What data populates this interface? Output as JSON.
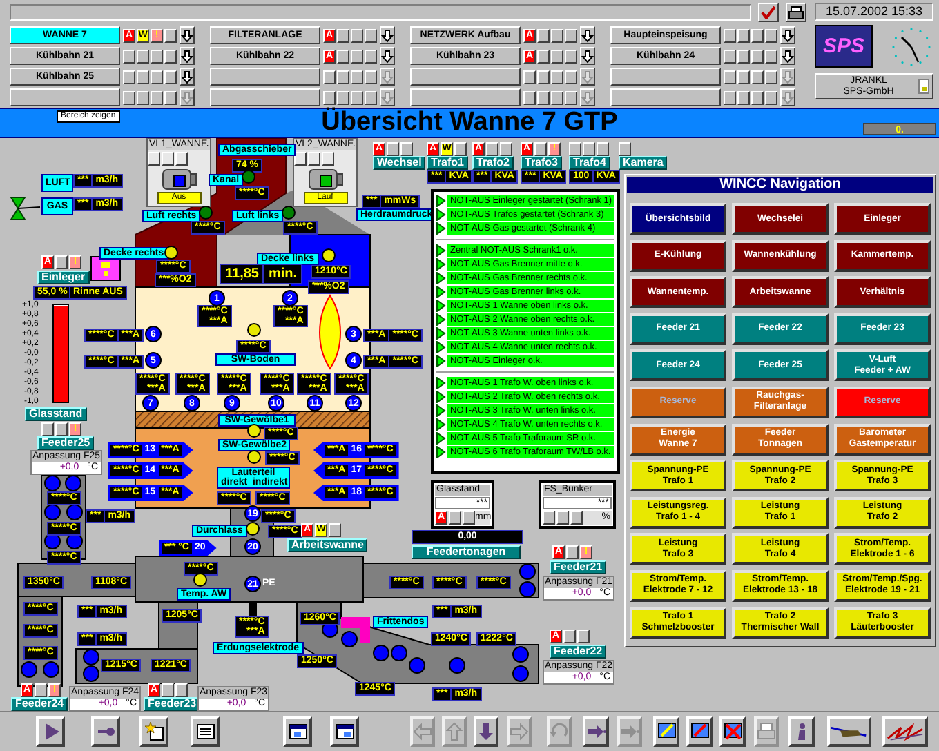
{
  "top_bar": {
    "datetime": "15.07.2002 15:33",
    "logo": "SPS",
    "company": [
      "JRANKL",
      "SPS-GmbH"
    ]
  },
  "areas": [
    {
      "label": "WANNE 7",
      "selected": true,
      "disabled": false,
      "alarms": [
        {
          "kind": "alarm",
          "text": "A"
        },
        {
          "kind": "warning",
          "text": "W"
        },
        {
          "kind": "info",
          "text": "!"
        },
        {
          "kind": "off"
        }
      ]
    },
    {
      "label": "FILTERANLAGE",
      "selected": false,
      "disabled": false,
      "alarms": [
        {
          "kind": "alarm",
          "text": "A"
        },
        {
          "kind": "off"
        },
        {
          "kind": "off"
        },
        {
          "kind": "off"
        }
      ]
    },
    {
      "label": "NETZWERK Aufbau",
      "selected": false,
      "disabled": false,
      "alarms": [
        {
          "kind": "alarm",
          "text": "A"
        },
        {
          "kind": "off"
        },
        {
          "kind": "off"
        },
        {
          "kind": "off"
        }
      ]
    },
    {
      "label": "Haupteinspeisung",
      "selected": false,
      "disabled": false,
      "alarms": [
        {
          "kind": "off"
        },
        {
          "kind": "off"
        },
        {
          "kind": "off"
        },
        {
          "kind": "off"
        }
      ]
    },
    {
      "label": "Kühlbahn 21",
      "selected": false,
      "disabled": false,
      "alarms": [
        {
          "kind": "off"
        },
        {
          "kind": "off"
        },
        {
          "kind": "off"
        },
        {
          "kind": "off"
        }
      ]
    },
    {
      "label": "Kühlbahn 22",
      "selected": false,
      "disabled": false,
      "alarms": [
        {
          "kind": "alarm",
          "text": "A"
        },
        {
          "kind": "off"
        },
        {
          "kind": "off"
        },
        {
          "kind": "off"
        }
      ]
    },
    {
      "label": "Kühlbahn 23",
      "selected": false,
      "disabled": false,
      "alarms": [
        {
          "kind": "alarm",
          "text": "A"
        },
        {
          "kind": "off"
        },
        {
          "kind": "off"
        },
        {
          "kind": "off"
        }
      ]
    },
    {
      "label": "Kühlbahn 24",
      "selected": false,
      "disabled": false,
      "alarms": [
        {
          "kind": "off"
        },
        {
          "kind": "off"
        },
        {
          "kind": "off"
        },
        {
          "kind": "off"
        }
      ]
    },
    {
      "label": "Kühlbahn 25",
      "selected": false,
      "disabled": false,
      "alarms": [
        {
          "kind": "off"
        },
        {
          "kind": "off"
        },
        {
          "kind": "off"
        },
        {
          "kind": "off"
        }
      ]
    },
    {
      "selected": false,
      "disabled": true,
      "alarms": [
        {
          "kind": "off"
        },
        {
          "kind": "off"
        },
        {
          "kind": "off"
        },
        {
          "kind": "off"
        }
      ]
    },
    {
      "selected": false,
      "disabled": true,
      "alarms": [
        {
          "kind": "off"
        },
        {
          "kind": "off"
        },
        {
          "kind": "off"
        },
        {
          "kind": "off"
        }
      ]
    },
    {
      "selected": false,
      "disabled": true,
      "alarms": [
        {
          "kind": "off"
        },
        {
          "kind": "off"
        },
        {
          "kind": "off"
        },
        {
          "kind": "off"
        }
      ]
    },
    {
      "selected": false,
      "disabled": true,
      "alarms": [
        {
          "kind": "off"
        },
        {
          "kind": "off"
        },
        {
          "kind": "off"
        },
        {
          "kind": "off"
        }
      ]
    },
    {
      "selected": false,
      "disabled": true,
      "alarms": [
        {
          "kind": "off"
        },
        {
          "kind": "off"
        },
        {
          "kind": "off"
        },
        {
          "kind": "off"
        }
      ]
    },
    {
      "selected": false,
      "disabled": true,
      "alarms": [
        {
          "kind": "off"
        },
        {
          "kind": "off"
        },
        {
          "kind": "off"
        },
        {
          "kind": "off"
        }
      ]
    },
    {
      "selected": false,
      "disabled": true,
      "alarms": [
        {
          "kind": "off"
        },
        {
          "kind": "off"
        },
        {
          "kind": "off"
        },
        {
          "kind": "off"
        }
      ]
    }
  ],
  "title_bar": {
    "button": "Bereich zeigen",
    "title": "Übersicht Wanne 7 GTP",
    "value": "0."
  },
  "plant": {
    "fans": [
      {
        "title": "VL1_WANNE",
        "status": "Aus",
        "running": false
      },
      {
        "title": "VL2_WANNE",
        "status": "Lauf",
        "running": true
      }
    ],
    "tags": [
      "Abgasschieber",
      "LUFT",
      "Kanal",
      "GAS",
      "Luft rechts",
      "Luft links",
      "Herdraumdruck",
      "Decke rechts",
      "Decke links",
      "SW-Boden",
      "SW-Gewölbe1",
      "SW-Gewölbe2",
      "Lauterteil\ndirekt  indirekt",
      "Durchlass",
      "Temp. AW",
      "Frittendos",
      "Erdungselektrode"
    ],
    "readouts": [
      [
        "74 %"
      ],
      [
        "***",
        "KVA"
      ],
      [
        "***",
        "KVA"
      ],
      [
        "***",
        "KVA"
      ],
      [
        "100",
        "KVA"
      ],
      [
        "***",
        "m3/h"
      ],
      [
        "****°C"
      ],
      [
        "***",
        "mmWs"
      ],
      [
        "***",
        "m3/h"
      ],
      [
        "****°C"
      ],
      [
        "****°C"
      ],
      [
        "****°C"
      ],
      [
        "11,85",
        "min."
      ],
      [
        "1210°C"
      ],
      [
        "***%O2"
      ],
      [
        "***%O2"
      ],
      [
        "55,0 %"
      ],
      [
        "Rinne AUS"
      ],
      [
        "****°C",
        "***A"
      ],
      [
        "****°C",
        "***A"
      ],
      [
        "****°C",
        "***A"
      ],
      [
        "***A",
        "****°C"
      ],
      [
        "****°C"
      ],
      [
        "****°C",
        "***A"
      ],
      [
        "***A",
        "****°C"
      ],
      [
        "****°C",
        "***A"
      ],
      [
        "****°C",
        "***A"
      ],
      [
        "****°C",
        "***A"
      ],
      [
        "****°C",
        "***A"
      ],
      [
        "****°C",
        "***A"
      ],
      [
        "****°C",
        "***A"
      ],
      [
        "****°C"
      ],
      [
        "****°C"
      ],
      [
        "****°C"
      ],
      [
        "****°C"
      ],
      [
        "****°C"
      ],
      [
        "***",
        "m3/h"
      ],
      [
        "****°C"
      ],
      [
        "****°C"
      ],
      [
        "****°C"
      ],
      [
        "0,00"
      ],
      [
        "****°C"
      ],
      [
        "****°C"
      ],
      [
        "1350°C"
      ],
      [
        "1108°C"
      ],
      [
        "****°C"
      ],
      [
        "****°C"
      ],
      [
        "****°C"
      ],
      [
        "****°C"
      ],
      [
        "***",
        "m3/h"
      ],
      [
        "***",
        "m3/h"
      ],
      [
        "1205°C"
      ],
      [
        "1260°C"
      ],
      [
        "****°C"
      ],
      [
        "****°C",
        "***A"
      ],
      [
        "***",
        "m3/h"
      ],
      [
        "1240°C"
      ],
      [
        "1222°C"
      ],
      [
        "****°C"
      ],
      [
        "1250°C"
      ],
      [
        "1215°C"
      ],
      [
        "1221°C"
      ],
      [
        "1245°C"
      ],
      [
        "***",
        "m3/h"
      ]
    ],
    "arrow_readouts": [
      {
        "kind": "right",
        "parts": [
          "****°C",
          "13",
          "***A"
        ]
      },
      {
        "kind": "left",
        "parts": [
          "***A",
          "16",
          "****°C"
        ]
      },
      {
        "kind": "right",
        "parts": [
          "****°C",
          "14",
          "***A"
        ]
      },
      {
        "kind": "left",
        "parts": [
          "***A",
          "17",
          "****°C"
        ]
      },
      {
        "kind": "right",
        "parts": [
          "****°C",
          "15",
          "***A"
        ]
      },
      {
        "kind": "left",
        "parts": [
          "***A",
          "18",
          "****°C"
        ]
      },
      {
        "kind": "right",
        "parts": [
          "*** °C",
          "20"
        ]
      }
    ],
    "electrodes": [
      "1",
      "2",
      "6",
      "3",
      "5",
      "4",
      "7",
      "8",
      "9",
      "10",
      "11",
      "12",
      "19",
      "20",
      "21"
    ],
    "pe_label": "PE",
    "lamps": [
      {
        "color": "#008000"
      },
      {
        "color": "#008000"
      },
      {
        "color": "#008000"
      },
      {
        "color": "#e8e800"
      },
      {
        "color": "#e8e800"
      },
      {
        "color": "#e8e800"
      },
      {
        "color": "#e8e800"
      },
      {
        "color": "#e8e800"
      },
      {
        "color": "#e8e800"
      },
      {
        "color": "#e8e800"
      }
    ],
    "units": [
      {
        "label": "Wechsel",
        "alarms": [
          {
            "kind": "alarm",
            "text": "A"
          },
          {
            "kind": "off"
          },
          {
            "kind": "off"
          }
        ]
      },
      {
        "label": "Trafo1",
        "alarms": [
          {
            "kind": "alarm",
            "text": "A"
          },
          {
            "kind": "warning",
            "text": "W"
          },
          {
            "kind": "off"
          }
        ]
      },
      {
        "label": "Trafo2",
        "alarms": [
          {
            "kind": "alarm",
            "text": "A"
          },
          {
            "kind": "off"
          },
          {
            "kind": "off"
          }
        ]
      },
      {
        "label": "Trafo3",
        "alarms": [
          {
            "kind": "alarm",
            "text": "A"
          },
          {
            "kind": "off"
          },
          {
            "kind": "info",
            "text": "!"
          }
        ]
      },
      {
        "label": "Trafo4",
        "alarms": [
          {
            "kind": "off"
          },
          {
            "kind": "off"
          },
          {
            "kind": "off"
          }
        ]
      },
      {
        "label": "Kamera",
        "alarms": [
          {
            "kind": "off"
          }
        ]
      },
      {
        "label": "Einleger",
        "alarms": [
          {
            "kind": "alarm",
            "text": "A"
          },
          {
            "kind": "off"
          },
          {
            "kind": "info",
            "text": "!"
          }
        ]
      },
      {
        "label": "Feeder25",
        "alarms": [
          {
            "kind": "off"
          },
          {
            "kind": "off"
          },
          {
            "kind": "info",
            "text": "!"
          }
        ],
        "adjust": {
          "label": "Anpassung F25",
          "value": "+0,0",
          "unit": "°C"
        }
      },
      {
        "label": "Arbeitswanne",
        "alarms": [
          {
            "kind": "alarm",
            "text": "A"
          },
          {
            "kind": "warning",
            "text": "W"
          },
          {
            "kind": "off"
          }
        ]
      },
      {
        "label": "Feeder21",
        "alarms": [
          {
            "kind": "alarm",
            "text": "A"
          },
          {
            "kind": "off"
          },
          {
            "kind": "info",
            "text": "!"
          }
        ],
        "adjust": {
          "label": "Anpassung F21",
          "value": "+0,0",
          "unit": "°C"
        }
      },
      {
        "label": "Feeder22",
        "alarms": [
          {
            "kind": "alarm",
            "text": "A"
          },
          {
            "kind": "off"
          },
          {
            "kind": "off"
          }
        ],
        "adjust": {
          "label": "Anpassung F22",
          "value": "+0,0",
          "unit": "°C"
        }
      },
      {
        "label": "Feeder24",
        "alarms": [
          {
            "kind": "alarm",
            "text": "A"
          },
          {
            "kind": "off"
          },
          {
            "kind": "info",
            "text": "!"
          }
        ],
        "adjust": {
          "label": "Anpassung F24",
          "value": "+0,0",
          "unit": "°C"
        }
      },
      {
        "label": "Feeder23",
        "alarms": [
          {
            "kind": "alarm",
            "text": "A"
          },
          {
            "kind": "off"
          },
          {
            "kind": "off"
          }
        ],
        "adjust": {
          "label": "Anpassung F23",
          "value": "+0,0",
          "unit": "°C"
        }
      }
    ],
    "glass_level": {
      "label": "Glasstand",
      "scale": [
        "+1,0",
        "+0,8",
        "+0,6",
        "+0,4",
        "+0,2",
        "-0,0",
        "-0,2",
        "-0,4",
        "-0,6",
        "-0,8",
        "-1,0"
      ],
      "level": 0.98
    },
    "mini_panels": [
      {
        "title": "Glasstand",
        "value": "***",
        "unit": "mm",
        "alarms": [
          {
            "kind": "alarm",
            "text": "A"
          },
          {
            "kind": "off"
          },
          {
            "kind": "off"
          }
        ]
      },
      {
        "title": "FS_Bunker",
        "value": "***",
        "unit": "%",
        "alarms": [
          {
            "kind": "off"
          },
          {
            "kind": "off"
          },
          {
            "kind": "off"
          }
        ]
      }
    ],
    "feeder_tonnage_label": "Feedertonagen",
    "emergency_stops": [
      [
        {
          "text": "NOT-AUS Einleger gestartet (Schrank 1)",
          "ok": true
        },
        {
          "text": "NOT-AUS Trafos gestartet (Schrank 3)",
          "ok": true
        },
        {
          "text": "NOT-AUS Gas gestartet (Schrank 4)",
          "ok": true
        }
      ],
      [
        {
          "text": "Zentral NOT-AUS Schrank1 o.k.",
          "ok": true
        },
        {
          "text": "NOT-AUS Gas Brenner mitte o.k.",
          "ok": true
        },
        {
          "text": "NOT-AUS Gas Brenner rechts o.k.",
          "ok": true
        },
        {
          "text": "NOT-AUS Gas Brenner links o.k.",
          "ok": true
        },
        {
          "text": "NOT-AUS 1 Wanne oben links o.k.",
          "ok": true
        },
        {
          "text": "NOT-AUS 2 Wanne oben rechts o.k.",
          "ok": true
        },
        {
          "text": "NOT-AUS 3 Wanne unten links o.k.",
          "ok": true
        },
        {
          "text": "NOT-AUS 4 Wanne unten rechts o.k.",
          "ok": true
        },
        {
          "text": "NOT-AUS Einleger o.k.",
          "ok": true
        }
      ],
      [
        {
          "text": "NOT-AUS 1 Trafo W. oben links o.k.",
          "ok": true
        },
        {
          "text": "NOT-AUS 2 Trafo W. oben rechts o.k.",
          "ok": true
        },
        {
          "text": "NOT-AUS 3 Trafo W. unten links o.k.",
          "ok": true
        },
        {
          "text": "NOT-AUS 4 Trafo W. unten rechts o.k.",
          "ok": true
        },
        {
          "text": "NOT-AUS 5 Trafo Traforaum SR o.k.",
          "ok": true
        },
        {
          "text": "NOT-AUS 6 Trafo Traforaum TW/LB o.k.",
          "ok": true
        }
      ]
    ]
  },
  "navigation": {
    "title": "WINCC Navigation",
    "buttons": [
      {
        "label": "Übersichtsbild",
        "color": "#000080",
        "disabled": false
      },
      {
        "label": "Wechselei",
        "color": "#800000",
        "disabled": false
      },
      {
        "label": "Einleger",
        "color": "#800000",
        "disabled": false
      },
      {
        "label": "E-Kühlung",
        "color": "#800000",
        "disabled": false
      },
      {
        "label": "Wannenkühlung",
        "color": "#800000",
        "disabled": false
      },
      {
        "label": "Kammertemp.",
        "color": "#800000",
        "disabled": false
      },
      {
        "label": "Wannentemp.",
        "color": "#800000",
        "disabled": false
      },
      {
        "label": "Arbeitswanne",
        "color": "#800000",
        "disabled": false
      },
      {
        "label": "Verhältnis",
        "color": "#800000",
        "disabled": false
      },
      {
        "label": "Feeder 21",
        "color": "#008080",
        "disabled": false
      },
      {
        "label": "Feeder 22",
        "color": "#008080",
        "disabled": false
      },
      {
        "label": "Feeder 23",
        "color": "#008080",
        "disabled": false
      },
      {
        "label": "Feeder 24",
        "color": "#008080",
        "disabled": false
      },
      {
        "label": "Feeder 25",
        "color": "#008080",
        "disabled": false
      },
      {
        "label": "V-Luft\nFeeder + AW",
        "color": "#008080",
        "disabled": false
      },
      {
        "label": "Reserve",
        "color": "#cc6010",
        "disabled": true
      },
      {
        "label": "Rauchgas-\nFilteranlage",
        "color": "#cc6010",
        "disabled": false
      },
      {
        "label": "Reserve",
        "color": "#ff0000",
        "disabled": true
      },
      {
        "label": "Energie\nWanne 7",
        "color": "#cc6010",
        "disabled": false
      },
      {
        "label": "Feeder\nTonnagen",
        "color": "#cc6010",
        "disabled": false
      },
      {
        "label": "Barometer\nGastemperatur",
        "color": "#cc6010",
        "disabled": false
      },
      {
        "label": "Spannung-PE\nTrafo 1",
        "color": "#e8e800",
        "disabled": false
      },
      {
        "label": "Spannung-PE\nTrafo 2",
        "color": "#e8e800",
        "disabled": false
      },
      {
        "label": "Spannung-PE\nTrafo 3",
        "color": "#e8e800",
        "disabled": false
      },
      {
        "label": "Leistungsreg.\nTrafo 1 - 4",
        "color": "#e8e800",
        "disabled": false
      },
      {
        "label": "Leistung\nTrafo 1",
        "color": "#e8e800",
        "disabled": false
      },
      {
        "label": "Leistung\nTrafo 2",
        "color": "#e8e800",
        "disabled": false
      },
      {
        "label": "Leistung\nTrafo 3",
        "color": "#e8e800",
        "disabled": false
      },
      {
        "label": "Leistung\nTrafo 4",
        "color": "#e8e800",
        "disabled": false
      },
      {
        "label": "Strom/Temp.\nElektrode 1 - 6",
        "color": "#e8e800",
        "disabled": false
      },
      {
        "label": "Strom/Temp.\nElektrode 7 - 12",
        "color": "#e8e800",
        "disabled": false
      },
      {
        "label": "Strom/Temp.\nElektrode 13 - 18",
        "color": "#e8e800",
        "disabled": false
      },
      {
        "label": "Strom/Temp./Spg.\nElektrode 19 - 21",
        "color": "#e8e800",
        "disabled": false
      },
      {
        "label": "Trafo 1\nSchmelzbooster",
        "color": "#e8e800",
        "disabled": false
      },
      {
        "label": "Trafo 2\nThermischer Wall",
        "color": "#e8e800",
        "disabled": false
      },
      {
        "label": "Trafo 3\nLäuterbooster",
        "color": "#e8e800",
        "disabled": false
      }
    ]
  },
  "toolbar": [
    {
      "disabled": false
    },
    {
      "disabled": false
    },
    {
      "disabled": false
    },
    {
      "disabled": false
    },
    {
      "disabled": false
    },
    {
      "disabled": false
    },
    {
      "disabled": true
    },
    {
      "disabled": true
    },
    {
      "disabled": false
    },
    {
      "disabled": true
    },
    {
      "disabled": true
    },
    {
      "disabled": false
    },
    {
      "disabled": true
    },
    {
      "disabled": false
    },
    {
      "disabled": false
    },
    {
      "disabled": false
    },
    {
      "disabled": true
    },
    {
      "disabled": false
    },
    {
      "disabled": false
    },
    {
      "disabled": false
    }
  ]
}
